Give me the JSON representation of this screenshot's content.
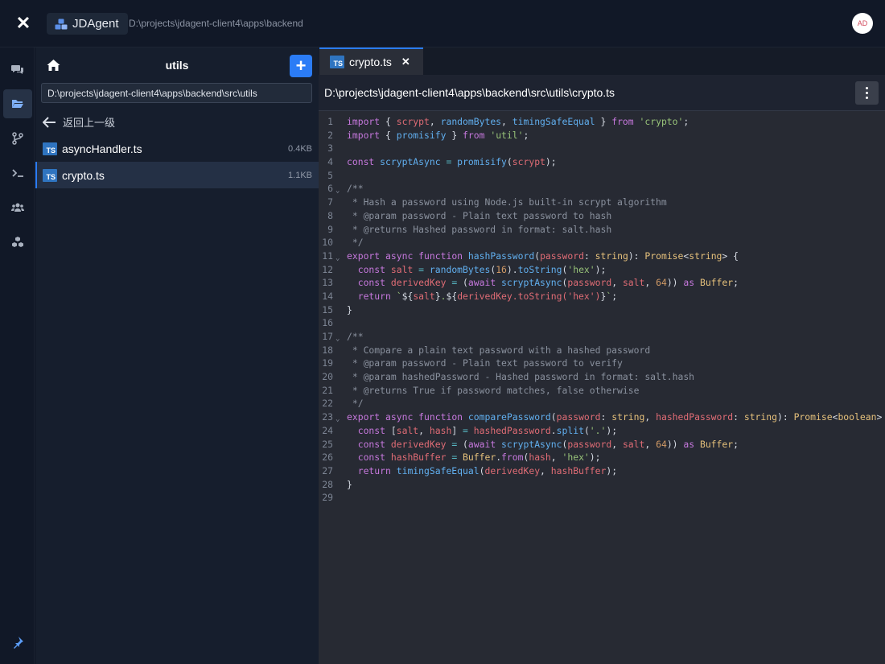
{
  "topbar": {
    "brand": "JDAgent",
    "path": "D:\\projects\\jdagent-client4\\apps\\backend",
    "avatar": "AD"
  },
  "rail": {
    "items": [
      "chat-icon",
      "folder-icon",
      "branch-icon",
      "terminal-icon",
      "users-icon",
      "cubes-icon"
    ],
    "active": "folder-icon",
    "bottom": "pin-icon"
  },
  "panel": {
    "title": "utils",
    "path_value": "D:\\projects\\jdagent-client4\\apps\\backend\\src\\utils",
    "back_label": "返回上一级",
    "files": [
      {
        "name": "asyncHandler.ts",
        "size": "0.4KB",
        "icon": "TS"
      },
      {
        "name": "crypto.ts",
        "size": "1.1KB",
        "icon": "TS"
      }
    ]
  },
  "editor": {
    "tab_label": "crypto.ts",
    "tab_icon": "TS",
    "file_path": "D:\\projects\\jdagent-client4\\apps\\backend\\src\\utils\\crypto.ts",
    "lines": [
      "import { scrypt, randomBytes, timingSafeEqual } from 'crypto';",
      "import { promisify } from 'util';",
      "",
      "const scryptAsync = promisify(scrypt);",
      "",
      "/**",
      " * Hash a password using Node.js built-in scrypt algorithm",
      " * @param password - Plain text password to hash",
      " * @returns Hashed password in format: salt.hash",
      " */",
      "export async function hashPassword(password: string): Promise<string> {",
      "  const salt = randomBytes(16).toString('hex');",
      "  const derivedKey = (await scryptAsync(password, salt, 64)) as Buffer;",
      "  return `${salt}.${derivedKey.toString('hex')}`;",
      "}",
      "",
      "/**",
      " * Compare a plain text password with a hashed password",
      " * @param password - Plain text password to verify",
      " * @param hashedPassword - Hashed password in format: salt.hash",
      " * @returns True if password matches, false otherwise",
      " */",
      "export async function comparePassword(password: string, hashedPassword: string): Promise<boolean> {",
      "  const [salt, hash] = hashedPassword.split('.');",
      "  const derivedKey = (await scryptAsync(password, salt, 64)) as Buffer;",
      "  const hashBuffer = Buffer.from(hash, 'hex');",
      "  return timingSafeEqual(derivedKey, hashBuffer);",
      "}",
      ""
    ],
    "fold_lines": [
      6,
      11,
      17,
      23
    ]
  }
}
